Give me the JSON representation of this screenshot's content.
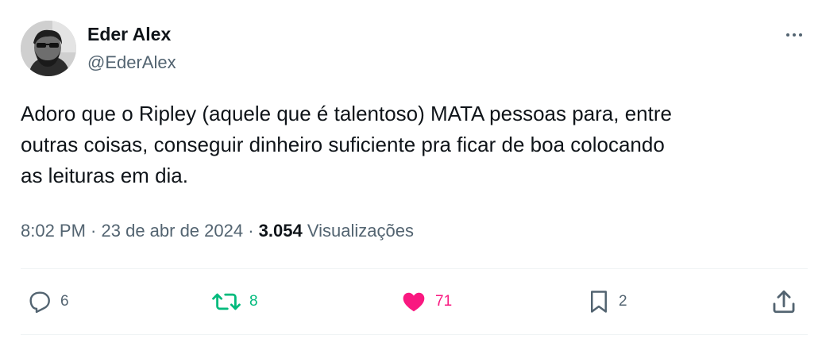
{
  "author": {
    "display_name": "Eder Alex",
    "handle": "@EderAlex"
  },
  "tweet": {
    "text": "Adoro que o Ripley (aquele que é talentoso) MATA pessoas para, entre\noutras coisas, conseguir dinheiro suficiente pra ficar de boa colocando\nas leituras em dia.",
    "time": "8:02 PM",
    "separator": " · ",
    "date": "23 de abr de 2024",
    "views_count": "3.054",
    "views_label": "Visualizações"
  },
  "actions": {
    "reply_count": "6",
    "retweet_count": "8",
    "like_count": "71",
    "bookmark_count": "2"
  },
  "icons": {
    "more": "more-horizontal-icon",
    "reply": "speech-bubble-icon",
    "retweet": "retweet-arrows-icon",
    "like": "heart-filled-icon",
    "bookmark": "bookmark-icon",
    "share": "share-upload-icon"
  },
  "colors": {
    "text_primary": "#0f1419",
    "text_secondary": "#536471",
    "retweet_active": "#00ba7c",
    "like_active": "#f91880",
    "divider": "#eff3f4"
  }
}
